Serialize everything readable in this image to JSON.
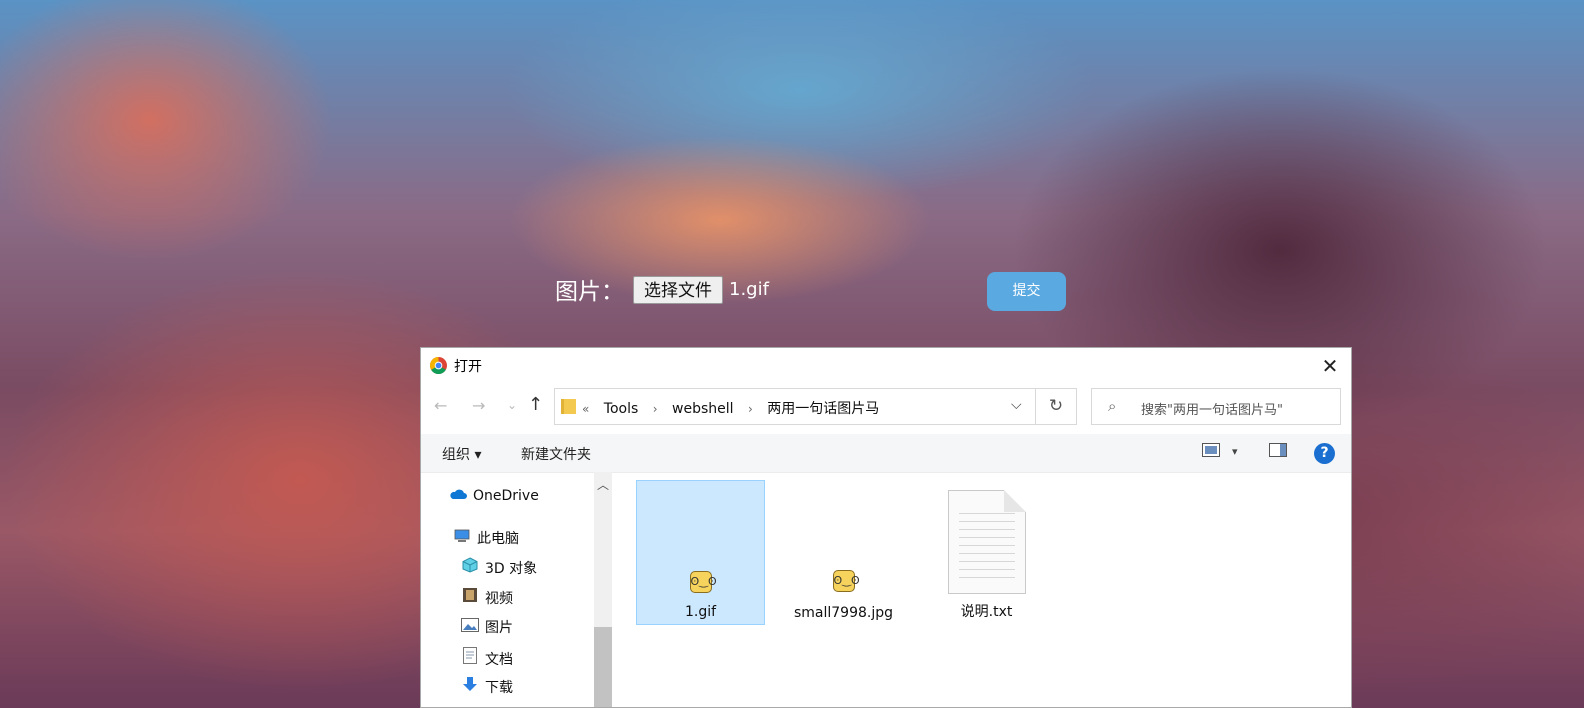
{
  "form": {
    "label": "图片：",
    "choose_button": "选择文件",
    "chosen_file": "1.gif",
    "submit": "提交"
  },
  "dialog": {
    "title": "打开",
    "close": "✕",
    "nav": {
      "back": "←",
      "forward": "→",
      "history": "⌄",
      "up": "↑"
    },
    "breadcrumb": [
      "Tools",
      "webshell",
      "两用一句话图片马"
    ],
    "breadcrumb_prefix": "«",
    "search_placeholder": "搜索\"两用一句话图片马\"",
    "toolbar": {
      "organize": "组织 ▾",
      "new_folder": "新建文件夹",
      "help": "?"
    },
    "sidebar": [
      {
        "label": "OneDrive",
        "icon": "cloud-icon"
      },
      {
        "label": "此电脑",
        "icon": "computer-icon"
      },
      {
        "label": "3D 对象",
        "icon": "cube-icon"
      },
      {
        "label": "视频",
        "icon": "film-icon"
      },
      {
        "label": "图片",
        "icon": "picture-icon"
      },
      {
        "label": "文档",
        "icon": "document-icon"
      },
      {
        "label": "下载",
        "icon": "download-arrow-icon"
      }
    ],
    "files": [
      {
        "name": "1.gif",
        "icon": "gif-image-icon",
        "selected": true
      },
      {
        "name": "small7998.jpg",
        "icon": "jpg-image-icon",
        "selected": false
      },
      {
        "name": "说明.txt",
        "icon": "text-file-icon",
        "selected": false
      }
    ]
  },
  "colors": {
    "submit_bg": "#5aa9e0",
    "selection_bg": "#cce8ff",
    "help_bg": "#1a6fd0"
  }
}
